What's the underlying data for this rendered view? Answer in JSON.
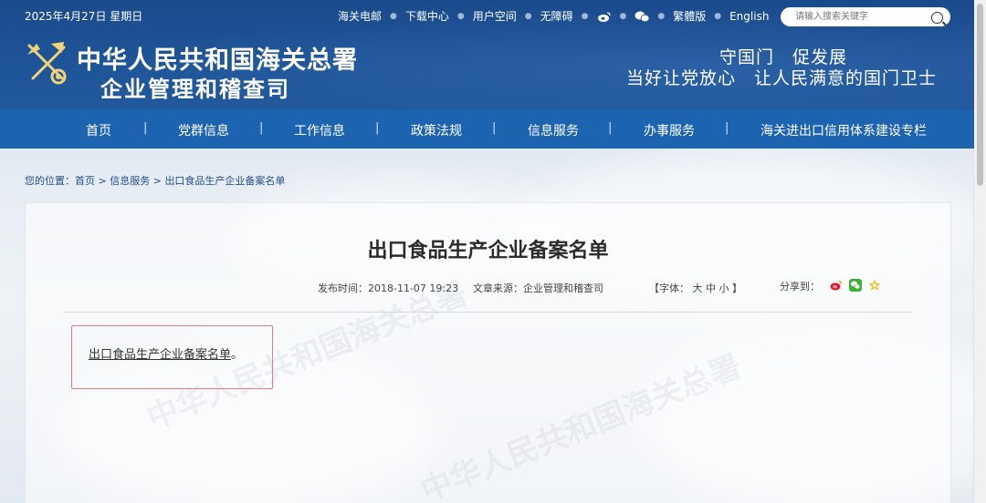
{
  "header": {
    "date": "2025年4月27日 星期日",
    "top_links": [
      "海关电邮",
      "下载中心",
      "用户空间",
      "无障碍"
    ],
    "traditional": "繁體版",
    "english": "English",
    "search_placeholder": "请输入搜索关键字",
    "org_line1": "中华人民共和国海关总署",
    "org_line2": "企业管理和稽查司",
    "slogan_line1": "守国门　促发展",
    "slogan_line2": "当好让党放心　让人民满意的国门卫士"
  },
  "nav": {
    "items": [
      "首页",
      "党群信息",
      "工作信息",
      "政策法规",
      "信息服务",
      "办事服务",
      "海关进出口信用体系建设专栏"
    ],
    "separator": "|"
  },
  "breadcrumb": {
    "label": "您的位置：",
    "items": [
      "首页",
      "信息服务",
      "出口食品生产企业备案名单"
    ],
    "separator": " > "
  },
  "article": {
    "title": "出口食品生产企业备案名单",
    "publish_time": "发布时间：2018-11-07 19:23",
    "source": "文章来源：企业管理和稽查司",
    "font_size_label": "【字体： 大  中  小 】",
    "share_label": "分享到：",
    "link_text": "出口食品生产企业备案名单",
    "link_suffix": "。"
  },
  "watermark_text": "中华人民共和国海关总署",
  "colors": {
    "header_blue": "#1a4a8c",
    "nav_blue": "#1d64b0",
    "breadcrumb_text": "#1f4f8d",
    "highlight_border": "#e07e7e"
  },
  "icons": [
    "search-icon",
    "weibo-icon",
    "wechat-icon",
    "customs-emblem-icon",
    "favorite-star-icon"
  ]
}
